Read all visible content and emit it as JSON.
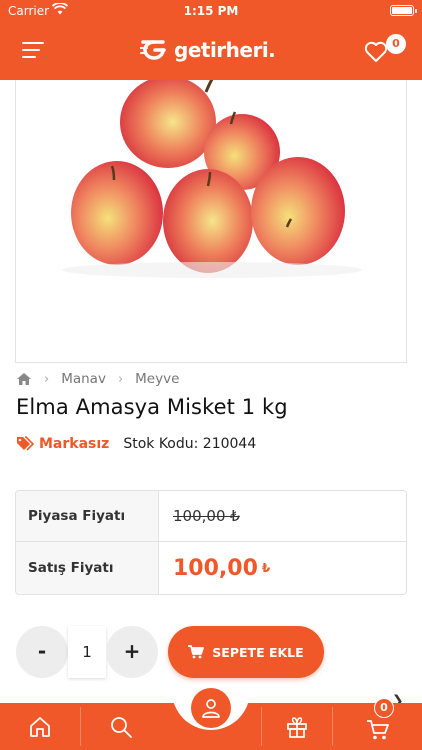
{
  "status_bar": {
    "carrier": "Carrier",
    "time": "1:15 PM"
  },
  "header": {
    "logo_text": "getirheri.",
    "favorites_count": "0",
    "icons": [
      "menu-icon",
      "heart-icon"
    ]
  },
  "breadcrumb": {
    "items": [
      "Manav",
      "Meyve"
    ],
    "icons": [
      "home-icon",
      "chevron-right-icon"
    ]
  },
  "product": {
    "title": "Elma Amasya Misket 1 kg",
    "brand": "Markasız",
    "stock_label": "Stok Kodu: 210044"
  },
  "prices": {
    "market_label": "Piyasa Fiyatı",
    "market_value": "100,00 ₺",
    "sale_label": "Satış Fiyatı",
    "sale_value": "100,00",
    "sale_currency": "₺"
  },
  "cart_controls": {
    "minus": "-",
    "plus": "+",
    "quantity": "1",
    "add_label": "SEPETE EKLE"
  },
  "bottom_nav": {
    "items": [
      "home-icon",
      "search-icon",
      "user-icon",
      "gift-icon",
      "cart-icon"
    ],
    "cart_count": "0"
  },
  "colors": {
    "accent": "#f0582a",
    "border": "#e2e2e2",
    "label_bg": "#f7f7f7"
  }
}
